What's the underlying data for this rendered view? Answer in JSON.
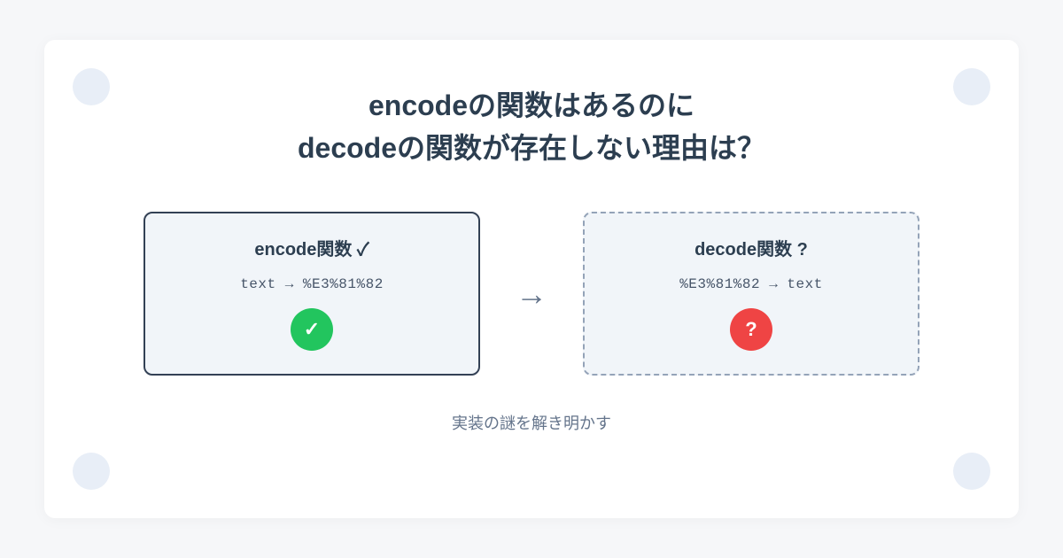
{
  "title": {
    "line1": "encodeの関数はあるのに",
    "line2": "decodeの関数が存在しない理由は？"
  },
  "boxes": {
    "encode": {
      "title": "encode関数 ✓",
      "code": "text → %E3%81%82",
      "badge_symbol": "✓"
    },
    "decode": {
      "title": "decode関数 ?",
      "code": "%E3%81%82 → text",
      "badge_symbol": "?"
    }
  },
  "arrow": "→",
  "footer": "実装の謎を解き明かす"
}
